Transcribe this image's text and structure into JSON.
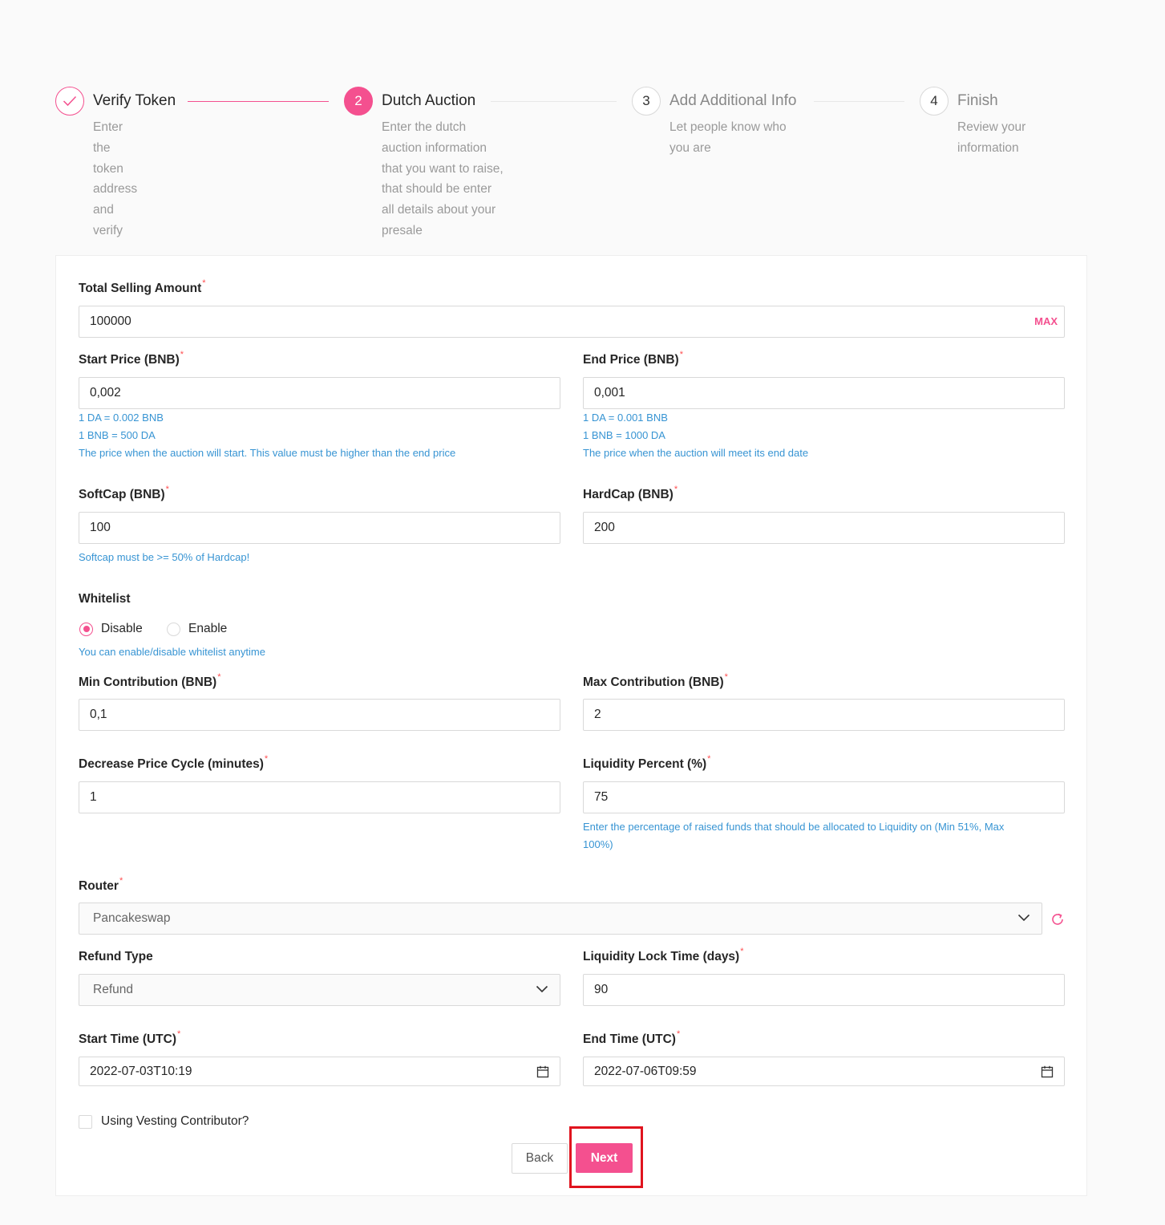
{
  "steps": [
    {
      "number": "1",
      "title": "Verify Token",
      "desc_lines": [
        "Enter the token",
        "address and verify"
      ],
      "state": "done"
    },
    {
      "number": "2",
      "title": "Dutch Auction",
      "desc_lines": [
        "Enter the dutch",
        "auction information",
        "that you want to raise,",
        "that should be enter",
        "all details about your",
        "presale"
      ],
      "state": "active"
    },
    {
      "number": "3",
      "title": "Add Additional Info",
      "desc_lines": [
        "Let people know who",
        "you are"
      ],
      "state": "wait"
    },
    {
      "number": "4",
      "title": "Finish",
      "desc_lines": [
        "Review your",
        "information"
      ],
      "state": "wait"
    }
  ],
  "form": {
    "total_selling": {
      "label": "Total Selling Amount",
      "value": "100000",
      "max_label": "MAX"
    },
    "start_price": {
      "label": "Start Price (BNB)",
      "value": "0,002",
      "hints": [
        "1 DA = 0.002 BNB",
        "1 BNB = 500 DA",
        "The price when the auction will start. This value must be higher than the end price"
      ]
    },
    "end_price": {
      "label": "End Price (BNB)",
      "value": "0,001",
      "hints": [
        "1 DA = 0.001 BNB",
        "1 BNB = 1000 DA",
        "The price when the auction will meet its end date"
      ]
    },
    "softcap": {
      "label": "SoftCap (BNB)",
      "value": "100",
      "hint": "Softcap must be >= 50% of Hardcap!"
    },
    "hardcap": {
      "label": "HardCap (BNB)",
      "value": "200"
    },
    "whitelist": {
      "label": "Whitelist",
      "options": [
        "Disable",
        "Enable"
      ],
      "selected": "Disable",
      "hint": "You can enable/disable whitelist anytime"
    },
    "min_contribution": {
      "label": "Min Contribution (BNB)",
      "value": "0,1"
    },
    "max_contribution": {
      "label": "Max Contribution (BNB)",
      "value": "2"
    },
    "decrease_cycle": {
      "label": "Decrease Price Cycle (minutes)",
      "value": "1"
    },
    "liquidity_percent": {
      "label": "Liquidity Percent (%)",
      "value": "75",
      "hint_lines": [
        "Enter the percentage of raised funds that should be allocated to Liquidity on (Min 51%, Max",
        "100%)"
      ]
    },
    "router": {
      "label": "Router",
      "value": "Pancakeswap"
    },
    "refund_type": {
      "label": "Refund Type",
      "value": "Refund"
    },
    "liquidity_lock": {
      "label": "Liquidity Lock Time (days)",
      "value": "90"
    },
    "start_time": {
      "label": "Start Time (UTC)",
      "value": "2022-07-03T10:19"
    },
    "end_time": {
      "label": "End Time (UTC)",
      "value": "2022-07-06T09:59"
    },
    "vesting": {
      "label": "Using Vesting Contributor?",
      "checked": false
    },
    "required_mark": "*"
  },
  "buttons": {
    "back": "Back",
    "next": "Next"
  },
  "colors": {
    "accent": "#f4508f",
    "hint": "#3794d3",
    "required": "#ff4d4f",
    "highlight": "#e0141e"
  }
}
